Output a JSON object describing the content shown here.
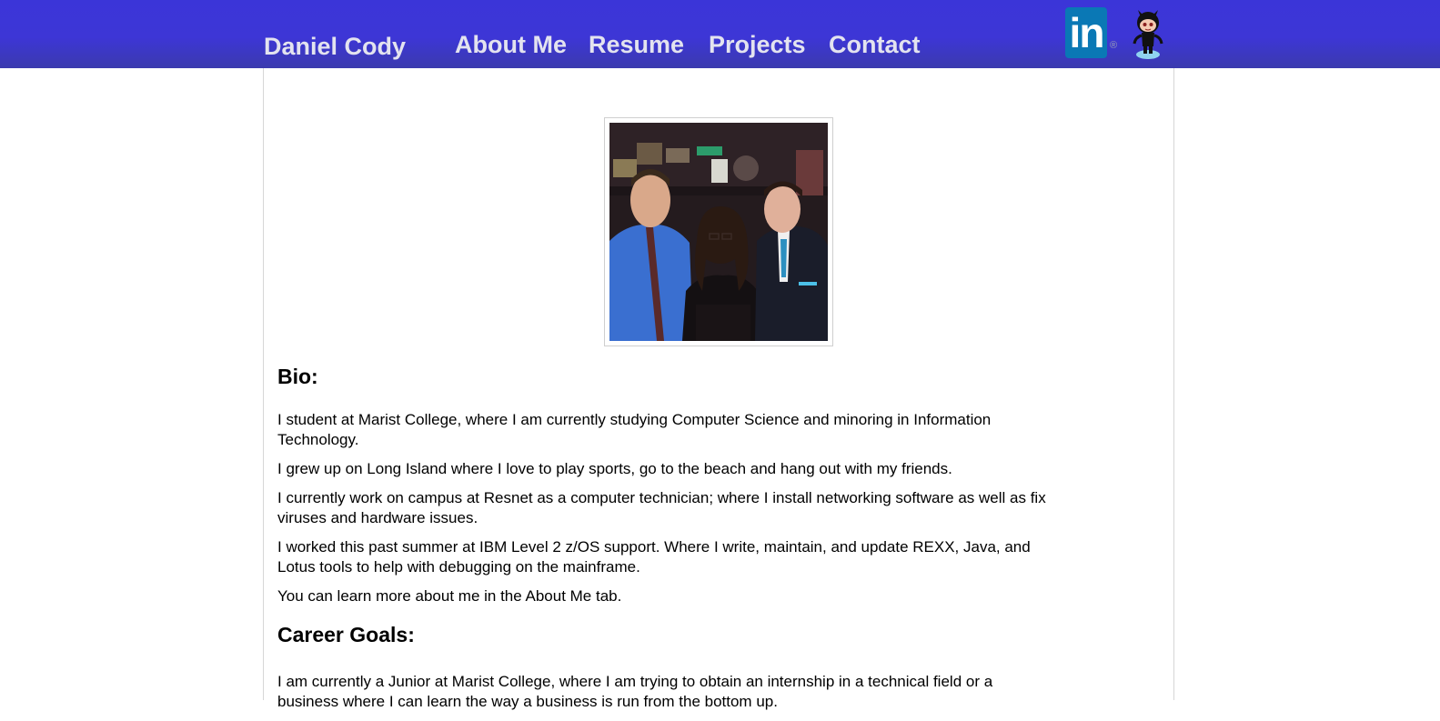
{
  "header": {
    "brand": "Daniel Cody",
    "nav": [
      "About Me",
      "Resume",
      "Projects",
      "Contact"
    ],
    "social": {
      "linkedin_text": "in",
      "linkedin_mark": "®",
      "linkedin_icon": "linkedin-icon",
      "github_icon": "github-octocat-icon"
    }
  },
  "main": {
    "photo_alt": "profile-photo",
    "bio": {
      "heading": "Bio:",
      "paragraphs": [
        "I student at Marist College, where I am currently studying Computer Science and minoring in Information Technology.",
        "I grew up on Long Island where I love to play sports, go to the beach and hang out with my friends.",
        "I currently work on campus at Resnet as a computer technician; where I install networking software as well as fix viruses and hardware issues.",
        "I worked this past summer at IBM Level 2 z/OS support. Where I write, maintain, and update REXX, Java, and Lotus tools to help with debugging on the mainframe.",
        "You can learn more about me in the About Me tab."
      ]
    },
    "career": {
      "heading": "Career Goals:",
      "paragraphs": [
        "I am currently a Junior at Marist College, where I am trying to obtain an internship in a technical field or a business where I can learn the way a business is run from the bottom up."
      ]
    }
  },
  "colors": {
    "navbar": "#3b35d8",
    "nav_text": "#e3e3ef",
    "linkedin": "#0a78b5"
  }
}
